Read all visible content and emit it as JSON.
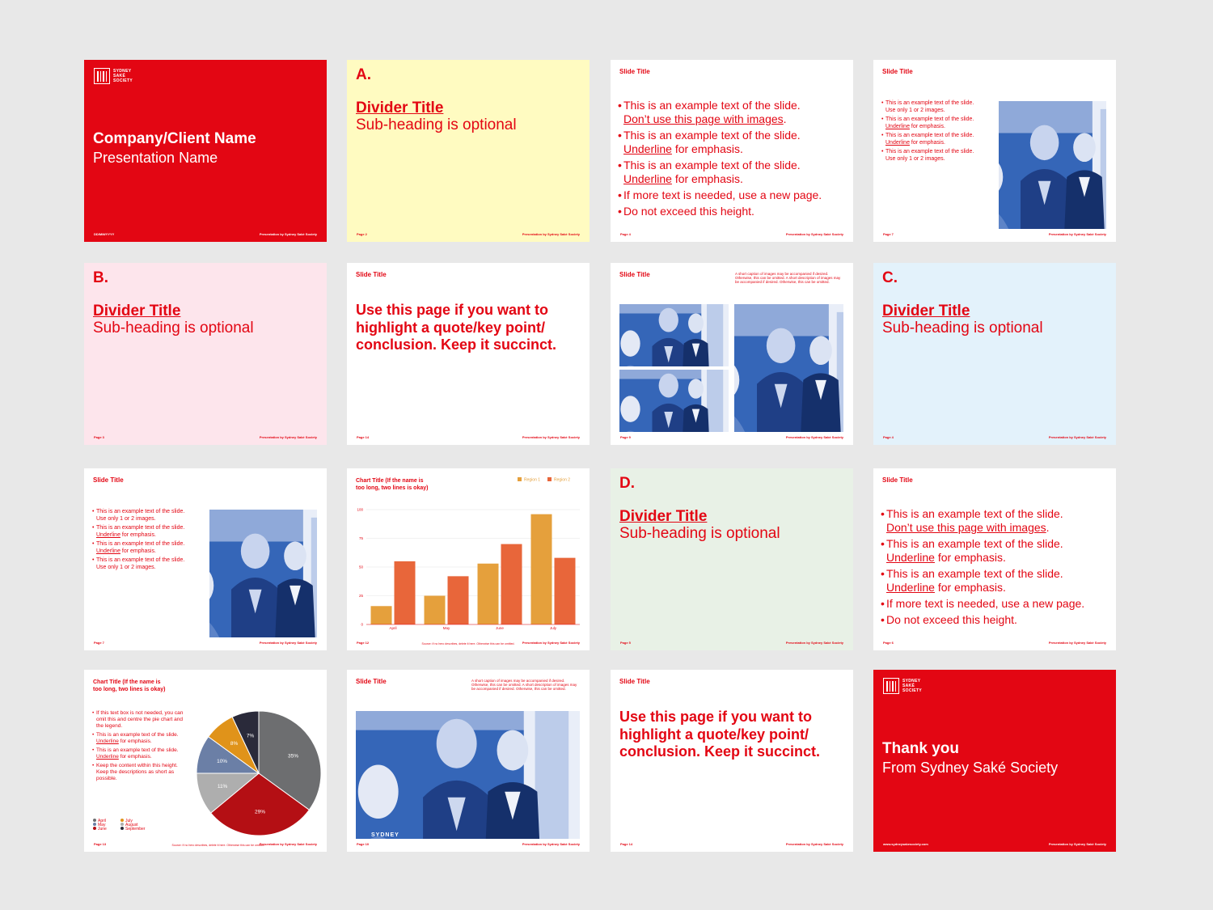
{
  "footer_brand": "Presentation by Sydney Saké Society",
  "slide1": {
    "logo_line1": "SYDNEY",
    "logo_line2": "SAKÉ",
    "logo_line3": "SOCIETY",
    "title": "Company/Client Name",
    "subtitle": "Presentation Name",
    "date": "DD/MM/YYYY"
  },
  "slide2": {
    "letter": "A.",
    "title": "Divider Title",
    "subtitle": "Sub-heading is optional",
    "page": "Page 2"
  },
  "slide3": {
    "title": "Slide Title",
    "page": "Page 4",
    "bullets": [
      {
        "pre": "This is an example text of the slide.",
        "u": "Don’t use this page with images",
        "post": "."
      },
      {
        "pre": "This is an example text of the slide.",
        "u": "Underline",
        "post": " for emphasis."
      },
      {
        "pre": "This is an example text of the slide.",
        "u": "Underline",
        "post": " for emphasis."
      },
      {
        "pre": "If more text is needed, use a new page.",
        "u": "",
        "post": ""
      },
      {
        "pre": "Do not exceed this height.",
        "u": "",
        "post": ""
      }
    ]
  },
  "slide4": {
    "title": "Slide Title",
    "page": "Page 7",
    "bullets": [
      {
        "pre": "This is an example text of the slide. Use only 1 or 2 images.",
        "u": "",
        "post": ""
      },
      {
        "pre": "This is an example text of the slide.",
        "u": "Underline",
        "post": " for emphasis."
      },
      {
        "pre": "This is an example text of the slide.",
        "u": "Underline",
        "post": " for emphasis."
      },
      {
        "pre": "This is an example text of the slide. Use only 1 or 2 images.",
        "u": "",
        "post": ""
      }
    ]
  },
  "slide5": {
    "letter": "B.",
    "title": "Divider Title",
    "subtitle": "Sub-heading is optional",
    "page": "Page 3"
  },
  "slide6": {
    "title": "Slide Title",
    "quote": "Use this page if you want to highlight a quote/key point/ conclusion. Keep it succinct.",
    "page": "Page 14"
  },
  "slide7": {
    "title": "Slide Title",
    "caption": "A short caption of images may be accompanied if desired. Otherwise, this can be omitted. A short description of images may be accompanied if desired. Otherwise, this can be omitted.",
    "page": "Page 9"
  },
  "slide8": {
    "letter": "C.",
    "title": "Divider Title",
    "subtitle": "Sub-heading is optional",
    "page": "Page 4"
  },
  "slide9": {
    "title": "Slide Title",
    "page": "Page 7",
    "bullets": [
      {
        "pre": "This is an example text of the slide. Use only 1 or 2 images.",
        "u": "",
        "post": ""
      },
      {
        "pre": "This is an example text of the slide.",
        "u": "Underline",
        "post": " for emphasis."
      },
      {
        "pre": "This is an example text of the slide.",
        "u": "Underline",
        "post": " for emphasis."
      },
      {
        "pre": "This is an example text of the slide. Use only 1 or 2 images.",
        "u": "",
        "post": ""
      }
    ]
  },
  "slide10": {
    "page": "Page 12",
    "source": "Source: If no hero describes, delete it here. Otherwise this can be omitted."
  },
  "slide11": {
    "letter": "D.",
    "title": "Divider Title",
    "subtitle": "Sub-heading is optional",
    "page": "Page 5"
  },
  "slide12": {
    "title": "Slide Title",
    "page": "Page 6",
    "bullets": [
      {
        "pre": "This is an example text of the slide.",
        "u": "Don’t use this page with images",
        "post": "."
      },
      {
        "pre": "This is an example text of the slide.",
        "u": "Underline",
        "post": " for emphasis."
      },
      {
        "pre": "This is an example text of the slide.",
        "u": "Underline",
        "post": " for emphasis."
      },
      {
        "pre": "If more text is needed, use a new page.",
        "u": "",
        "post": ""
      },
      {
        "pre": "Do not exceed this height.",
        "u": "",
        "post": ""
      }
    ]
  },
  "slide13": {
    "page": "Page 13",
    "source": "Source: If no hero describes, delete it here. Otherwise this can be omitted.",
    "bullets": [
      {
        "pre": "If this text box is not needed, you can omit this and centre the pie chart and the legend.",
        "u": "",
        "post": ""
      },
      {
        "pre": "This is an example text of the slide.",
        "u": "Underline",
        "post": " for emphasis."
      },
      {
        "pre": "This is an example text of the slide.",
        "u": "Underline",
        "post": " for emphasis."
      },
      {
        "pre": "Keep the content within this height. Keep the descriptions as short as possible.",
        "u": "",
        "post": ""
      }
    ]
  },
  "slide14": {
    "title": "Slide Title",
    "caption": "A short caption of images may be accompanied if desired. Otherwise, this can be omitted. A short description of images may be accompanied if desired. Otherwise, this can be omitted.",
    "page": "Page 10",
    "photo_text": "SYDNEY"
  },
  "slide15": {
    "title": "Slide Title",
    "quote": "Use this page if you want to highlight a quote/key point/ conclusion. Keep it succinct.",
    "page": "Page 14"
  },
  "slide16": {
    "logo_line1": "SYDNEY",
    "logo_line2": "SAKÉ",
    "logo_line3": "SOCIETY",
    "title": "Thank you",
    "subtitle": "From Sydney Saké Society",
    "url": "www.sydneysakesociety.com"
  },
  "chart_data": [
    {
      "type": "bar",
      "title": "Chart Title (If the name is too long, two lines is okay)",
      "categories": [
        "April",
        "May",
        "June",
        "July"
      ],
      "series": [
        {
          "name": "Region 1",
          "values": [
            16,
            25,
            53,
            96
          ]
        },
        {
          "name": "Region 2",
          "values": [
            55,
            42,
            70,
            58
          ]
        }
      ],
      "ylim": [
        0,
        100
      ],
      "yticks": [
        0,
        25,
        50,
        75,
        100
      ],
      "colors": [
        "#e5a03c",
        "#e8663a"
      ],
      "grid": true,
      "legend": "top-right"
    },
    {
      "type": "pie",
      "title": "Chart Title (If the name is too long, two lines is okay)",
      "labels": [
        "April",
        "June",
        "August",
        "May",
        "July",
        "September"
      ],
      "values": [
        35,
        29,
        11,
        10,
        8,
        7
      ],
      "colors": [
        "#6d6e70",
        "#b40f14",
        "#aeaeae",
        "#6b7fa6",
        "#e0931a",
        "#2a2a3a"
      ],
      "legend": "bottom-left"
    }
  ]
}
